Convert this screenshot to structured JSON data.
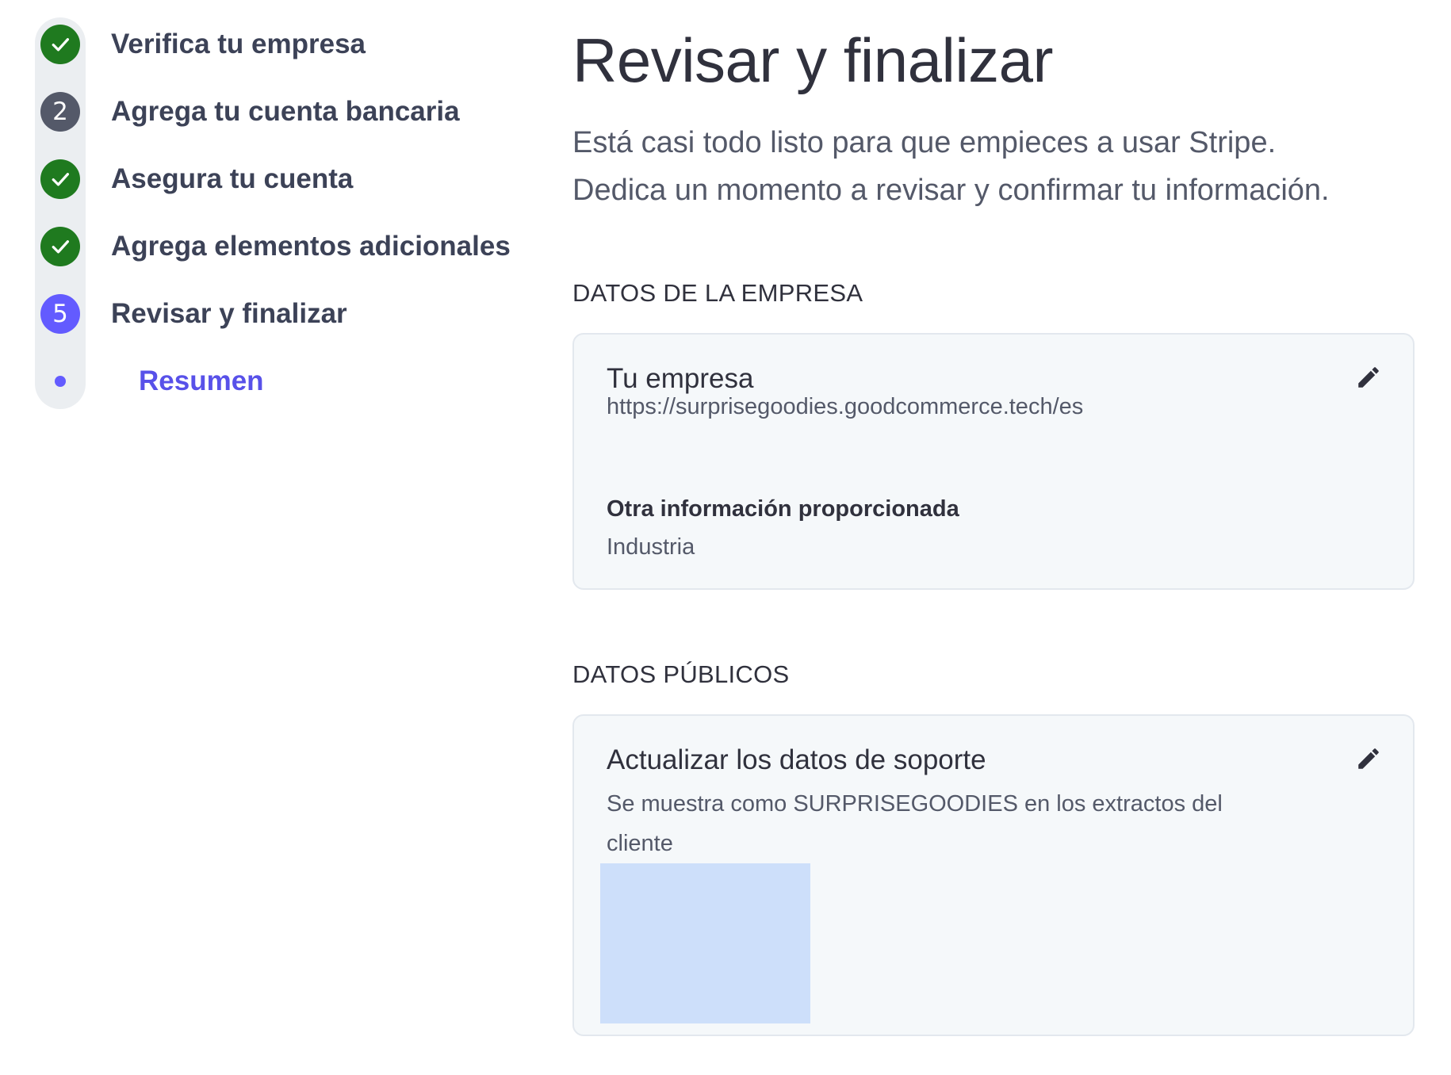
{
  "sidebar": {
    "steps": [
      {
        "label": "Verifica tu empresa",
        "status": "done",
        "icon": "check-icon"
      },
      {
        "label": "Agrega tu cuenta bancaria",
        "status": "pending",
        "number": "2"
      },
      {
        "label": "Asegura tu cuenta",
        "status": "done",
        "icon": "check-icon"
      },
      {
        "label": "Agrega elementos adicionales",
        "status": "done",
        "icon": "check-icon"
      },
      {
        "label": "Revisar y finalizar",
        "status": "current",
        "number": "5"
      }
    ],
    "substep": {
      "label": "Resumen",
      "active": true
    }
  },
  "main": {
    "title": "Revisar y finalizar",
    "description_line1": "Está casi todo listo para que empieces a usar Stripe.",
    "description_line2": "Dedica un momento a revisar y confirmar tu información.",
    "business_section": {
      "heading": "DATOS DE LA EMPRESA",
      "card": {
        "title": "Tu empresa",
        "url": "https://surprisegoodies.goodcommerce.tech/es",
        "other_info_label": "Otra información proporcionada",
        "other_info_value": "Industria",
        "edit_icon": "pencil-icon"
      }
    },
    "public_section": {
      "heading": "DATOS PÚBLICOS",
      "card": {
        "title": "Actualizar los datos de soporte",
        "text_line1": "Se muestra como SURPRISEGOODIES en los extractos del",
        "text_line2": "cliente",
        "edit_icon": "pencil-icon"
      }
    }
  },
  "colors": {
    "accent": "#635bff",
    "done": "#1f7a1f",
    "pending": "#545969",
    "card_bg": "#f5f8fa",
    "image_placeholder": "#cddffa"
  }
}
